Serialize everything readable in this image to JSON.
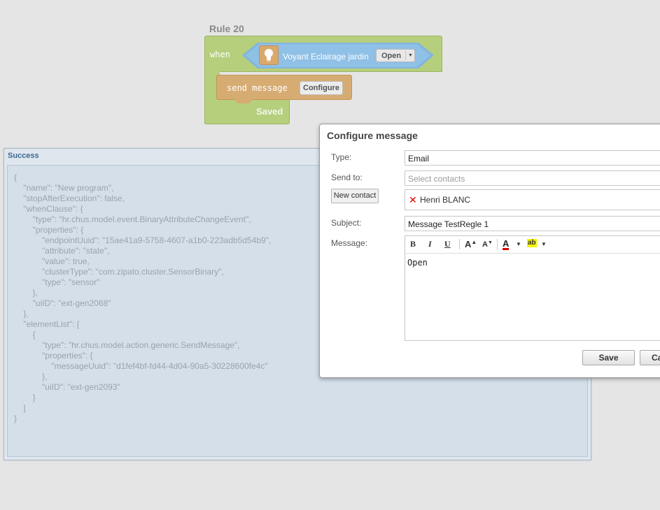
{
  "rule": {
    "title": "Rule 20",
    "when_label": "when",
    "event": {
      "icon": "lightbulb-icon",
      "device": "Voyant Eclairage jardin",
      "state": "Open"
    },
    "action": {
      "label": "send message",
      "configure_label": "Configure"
    },
    "status": "Saved"
  },
  "success_panel": {
    "title": "Success",
    "json_lines": [
      "{",
      "    \"name\": \"New program\",",
      "    \"stopAfterExecution\": false,",
      "    \"whenClause\": {",
      "        \"type\": \"hr.chus.model.event.BinaryAttributeChangeEvent\",",
      "        \"properties\": {",
      "            \"endpointUuid\": \"15ae41a9-5758-4607-a1b0-223adb5d54b9\",",
      "            \"attribute\": \"state\",",
      "            \"value\": true,",
      "            \"clusterType\": \"com.zipato.cluster.SensorBinary\",",
      "            \"type\": \"sensor\"",
      "        },",
      "        \"uiID\": \"ext-gen2068\"",
      "    },",
      "    \"elementList\": [",
      "        {",
      "            \"type\": \"hr.chus.model.action.generic.SendMessage\",",
      "            \"properties\": {",
      "                \"messageUuid\": \"d1fef4bf-fd44-4d04-90a5-30228600fe4c\"",
      "            },",
      "            \"uiID\": \"ext-gen2093\"",
      "        }",
      "    ]",
      "}"
    ]
  },
  "dialog": {
    "title": "Configure message",
    "type_label": "Type:",
    "type_value": "Email",
    "send_to_label": "Send to:",
    "send_to_placeholder": "Select contacts",
    "new_contact_label": "New contact",
    "contacts": [
      {
        "remove_icon": "✕",
        "name": "Henri BLANC"
      }
    ],
    "subject_label": "Subject:",
    "subject_value": "Message TestRegle 1",
    "message_label": "Message:",
    "toolbar": {
      "bold": "B",
      "italic": "I",
      "underline": "U",
      "grow": "A",
      "shrink": "A",
      "font_color": "A",
      "highlight": "ab"
    },
    "message_body": "Open",
    "save_label": "Save",
    "cancel_label": "Ca"
  },
  "colors": {
    "when_block": "#b5cf7d",
    "event_block": "#8fc0e6",
    "action_block": "#d7ac73",
    "success_title": "#3c6895"
  }
}
